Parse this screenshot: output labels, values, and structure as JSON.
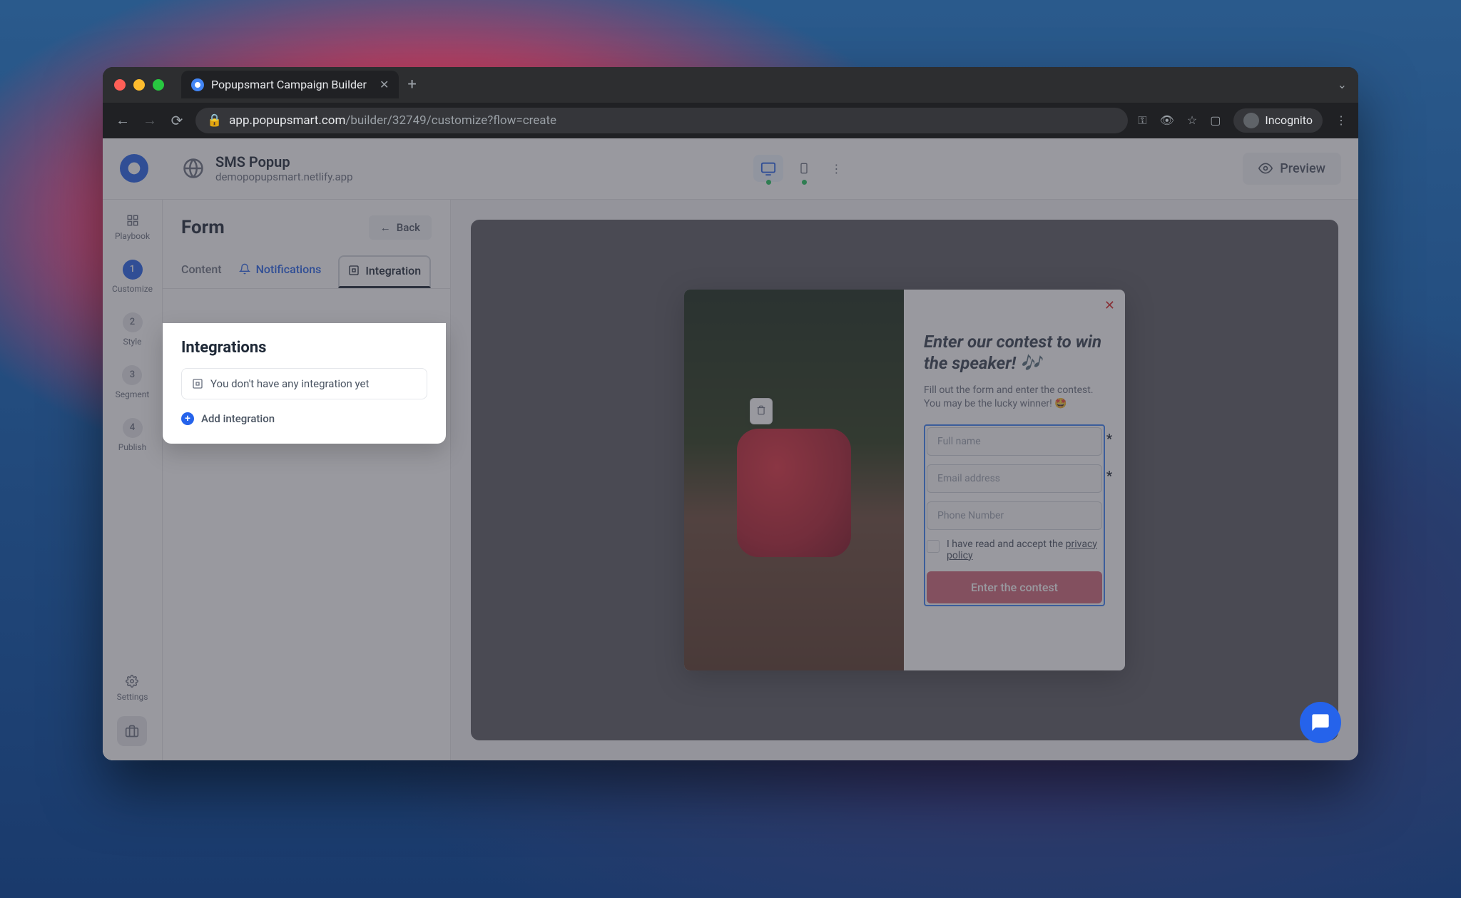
{
  "browser": {
    "tab_title": "Popupsmart Campaign Builder",
    "url_host": "app.popupsmart.com",
    "url_path": "/builder/32749/customize?flow=create",
    "incognito_label": "Incognito"
  },
  "header": {
    "popup_name": "SMS Popup",
    "domain": "demopopupsmart.netlify.app",
    "preview_label": "Preview"
  },
  "sidebar": {
    "items": [
      {
        "label": "Playbook"
      },
      {
        "step": "1",
        "label": "Customize"
      },
      {
        "step": "2",
        "label": "Style"
      },
      {
        "step": "3",
        "label": "Segment"
      },
      {
        "step": "4",
        "label": "Publish"
      }
    ],
    "settings_label": "Settings"
  },
  "panel": {
    "title": "Form",
    "back_label": "Back",
    "tabs": {
      "content": "Content",
      "notifications": "Notifications",
      "integration": "Integration"
    }
  },
  "popover": {
    "title": "Integrations",
    "empty_message": "You don't have any integration yet",
    "add_label": "Add integration"
  },
  "preview": {
    "heading": "Enter our contest to win the speaker! 🎶",
    "description": "Fill out the form and enter the contest. You may be the lucky winner! 🤩",
    "fullname_placeholder": "Full name",
    "email_placeholder": "Email address",
    "phone_placeholder": "Phone Number",
    "checkbox_prefix": "I have read and accept the ",
    "checkbox_link": "privacy policy",
    "submit_label": "Enter the contest"
  }
}
